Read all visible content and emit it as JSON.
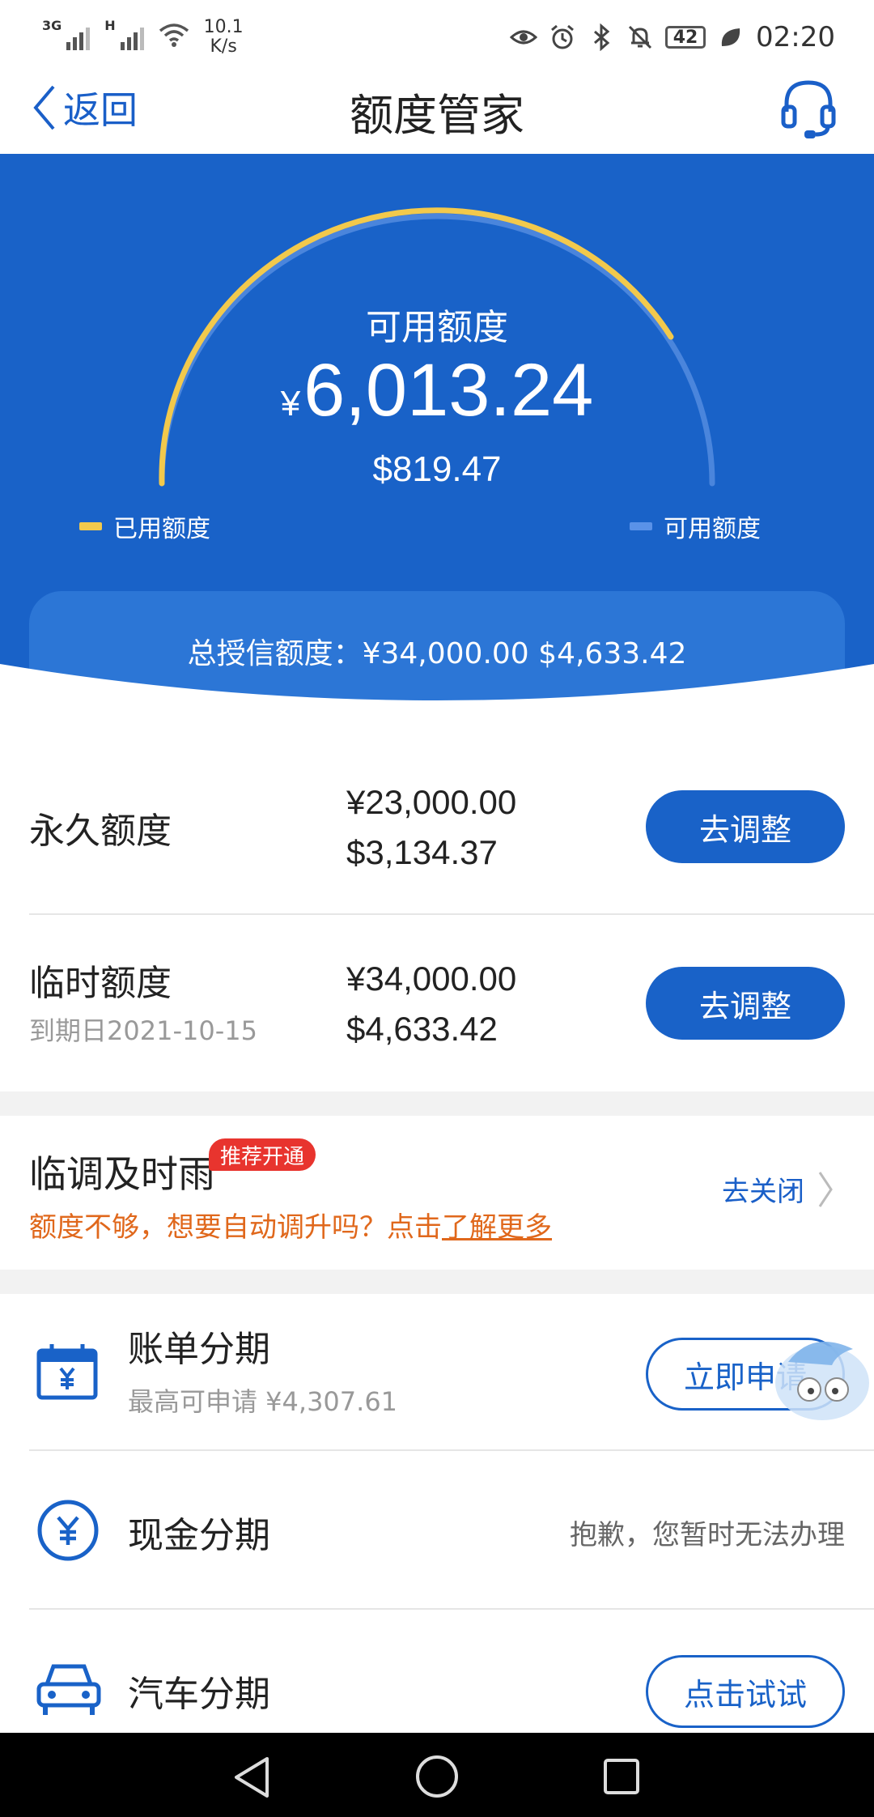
{
  "status": {
    "net1": "3G",
    "net2": "H",
    "speed_value": "10.1",
    "speed_unit": "K/s",
    "battery": "42",
    "time": "02:20"
  },
  "nav": {
    "back_label": "返回",
    "title": "额度管家"
  },
  "hero": {
    "available_label": "可用额度",
    "available_currency": "¥",
    "available_rmb": "6,013.24",
    "available_usd": "$819.47",
    "legend_used": "已用额度",
    "legend_available": "可用额度",
    "used_color": "#f2c94c",
    "available_color": "#5a92e8",
    "total_text": "总授信额度：¥34,000.00  $4,633.42"
  },
  "quotas": [
    {
      "name": "永久额度",
      "sub": "",
      "rmb": "¥23,000.00",
      "usd": "$3,134.37",
      "button": "去调整"
    },
    {
      "name": "临时额度",
      "sub": "到期日2021-10-15",
      "rmb": "¥34,000.00",
      "usd": "$4,633.42",
      "button": "去调整"
    }
  ],
  "auto_raise": {
    "title": "临调及时雨",
    "badge": "推荐开通",
    "desc": "额度不够，想要自动调升吗？点击",
    "link": "了解更多",
    "action": "去关闭"
  },
  "installments": [
    {
      "name": "账单分期",
      "sub": "最高可申请 ¥4,307.61",
      "button": "立即申请",
      "icon": "calendar-icon"
    },
    {
      "name": "现金分期",
      "message": "抱歉，您暂时无法办理",
      "icon": "yuan-coin-icon"
    },
    {
      "name": "汽车分期",
      "button": "点击试试",
      "icon": "car-icon"
    }
  ],
  "theme": {
    "primary": "#1962c8",
    "accent_orange": "#e0681c",
    "badge_red": "#e8342e"
  }
}
